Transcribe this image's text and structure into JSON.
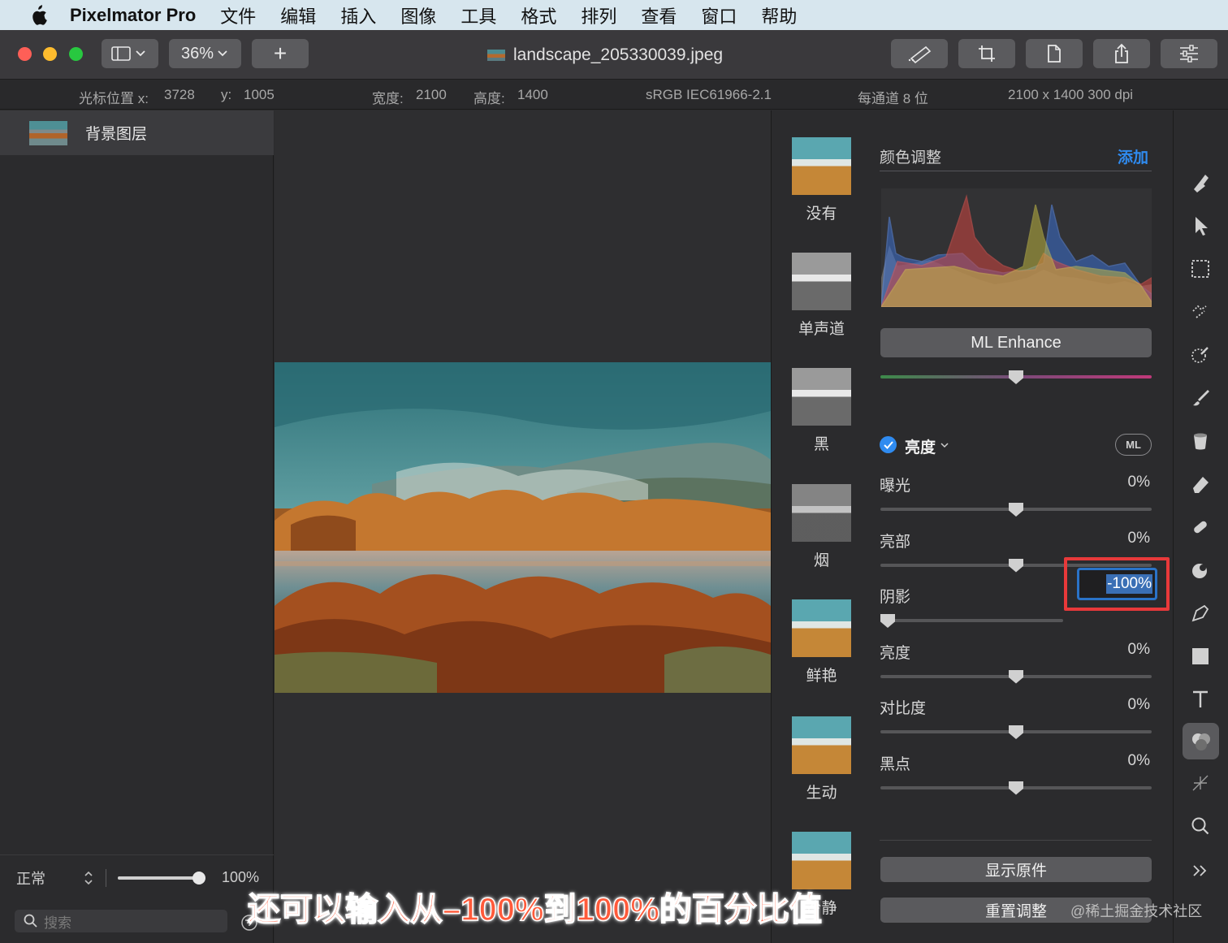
{
  "menubar": {
    "app_name": "Pixelmator Pro",
    "items": [
      "文件",
      "编辑",
      "插入",
      "图像",
      "工具",
      "格式",
      "排列",
      "查看",
      "窗口",
      "帮助"
    ]
  },
  "toolbar": {
    "zoom": "36%",
    "add_label": "+",
    "document_title": "landscape_205330039.jpeg"
  },
  "infobar": {
    "cursor_x_label": "光标位置 x:",
    "cursor_x": "3728",
    "cursor_y_label": "y:",
    "cursor_y": "1005",
    "width_label": "宽度:",
    "width": "2100",
    "height_label": "高度:",
    "height": "1400",
    "color_profile": "sRGB IEC61966-2.1",
    "bit_depth": "每通道 8 位",
    "dimensions": "2100 x 1400 300 dpi"
  },
  "layers": {
    "items": [
      {
        "name": "背景图层"
      }
    ],
    "blend_mode": "正常",
    "opacity": "100%",
    "opacity_fraction": 1.0,
    "search_placeholder": "搜索"
  },
  "presets": [
    "没有",
    "单声道",
    "黑",
    "烟",
    "鲜艳",
    "生动",
    "冷静"
  ],
  "adjustments": {
    "header": "颜色调整",
    "add_label": "添加",
    "ml_enhance": "ML Enhance",
    "section_name": "亮度",
    "ml_badge": "ML",
    "rows": [
      {
        "label": "曝光",
        "value": "0%",
        "fraction": 0.5
      },
      {
        "label": "亮部",
        "value": "0%",
        "fraction": 0.5
      },
      {
        "label": "阴影",
        "value": "-100%",
        "fraction": 0.0
      },
      {
        "label": "亮度",
        "value": "0%",
        "fraction": 0.5
      },
      {
        "label": "对比度",
        "value": "0%",
        "fraction": 0.5
      },
      {
        "label": "黑点",
        "value": "0%",
        "fraction": 0.5
      }
    ],
    "show_original": "显示原件",
    "reset": "重置调整"
  },
  "overlay": {
    "caption": "还可以输入从–100%到100%的百分比值",
    "watermark": "@稀土掘金技术社区"
  },
  "colors": {
    "accent": "#2f8bf0",
    "highlight_box": "#e8393a"
  }
}
